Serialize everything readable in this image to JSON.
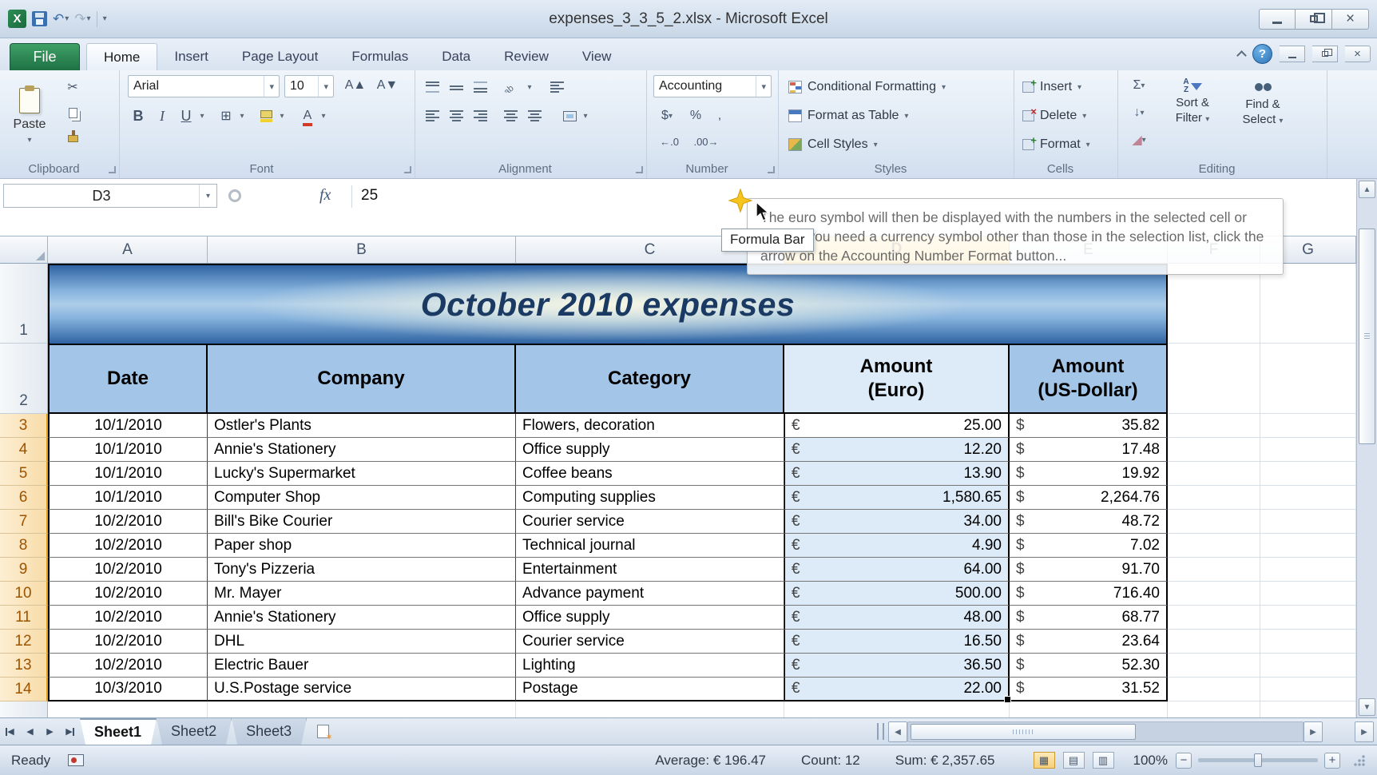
{
  "window": {
    "title": "expenses_3_3_5_2.xlsx  -  Microsoft Excel"
  },
  "tabs": {
    "file": "File",
    "items": [
      "Home",
      "Insert",
      "Page Layout",
      "Formulas",
      "Data",
      "Review",
      "View"
    ]
  },
  "ribbon": {
    "paste_label": "Paste",
    "font_name": "Arial",
    "font_size": "10",
    "number_format": "Accounting",
    "conditional_formatting": "Conditional Formatting",
    "format_as_table": "Format as Table",
    "cell_styles": "Cell Styles",
    "insert_label": "Insert",
    "delete_label": "Delete",
    "format_label": "Format",
    "sort_line1": "Sort &",
    "sort_line2": "Filter",
    "find_line1": "Find &",
    "find_line2": "Select",
    "groups": {
      "clipboard": "Clipboard",
      "font": "Font",
      "alignment": "Alignment",
      "number": "Number",
      "styles": "Styles",
      "cells": "Cells",
      "editing": "Editing"
    },
    "tooltip": "The euro symbol will then be displayed with the numbers in the selected cell or cells. If you need a currency symbol other than those in the selection list, click the arrow on the Accounting Number Format button..."
  },
  "formula_bar": {
    "name_box": "D3",
    "fx": "fx",
    "value": "25",
    "tooltip": "Formula Bar"
  },
  "sheet": {
    "columns": [
      "A",
      "B",
      "C",
      "D",
      "E",
      "F",
      "G"
    ],
    "selected_column": "D",
    "row1_num": "1",
    "row2_num": "2",
    "title": "October 2010 expenses",
    "headers": {
      "date": "Date",
      "company": "Company",
      "category": "Category",
      "eur1": "Amount",
      "eur2": "(Euro)",
      "usd1": "Amount",
      "usd2": "(US-Dollar)"
    },
    "currency": {
      "eur": "€",
      "usd": "$"
    },
    "rows": [
      {
        "n": 3,
        "date": "10/1/2010",
        "company": "Ostler's Plants",
        "category": "Flowers, decoration",
        "eur": "25.00",
        "usd": "35.82"
      },
      {
        "n": 4,
        "date": "10/1/2010",
        "company": "Annie's Stationery",
        "category": "Office supply",
        "eur": "12.20",
        "usd": "17.48"
      },
      {
        "n": 5,
        "date": "10/1/2010",
        "company": "Lucky's Supermarket",
        "category": "Coffee beans",
        "eur": "13.90",
        "usd": "19.92"
      },
      {
        "n": 6,
        "date": "10/1/2010",
        "company": "Computer Shop",
        "category": "Computing supplies",
        "eur": "1,580.65",
        "usd": "2,264.76"
      },
      {
        "n": 7,
        "date": "10/2/2010",
        "company": "Bill's Bike Courier",
        "category": "Courier service",
        "eur": "34.00",
        "usd": "48.72"
      },
      {
        "n": 8,
        "date": "10/2/2010",
        "company": "Paper shop",
        "category": "Technical journal",
        "eur": "4.90",
        "usd": "7.02"
      },
      {
        "n": 9,
        "date": "10/2/2010",
        "company": "Tony's Pizzeria",
        "category": "Entertainment",
        "eur": "64.00",
        "usd": "91.70"
      },
      {
        "n": 10,
        "date": "10/2/2010",
        "company": "Mr. Mayer",
        "category": "Advance payment",
        "eur": "500.00",
        "usd": "716.40"
      },
      {
        "n": 11,
        "date": "10/2/2010",
        "company": "Annie's Stationery",
        "category": "Office supply",
        "eur": "48.00",
        "usd": "68.77"
      },
      {
        "n": 12,
        "date": "10/2/2010",
        "company": "DHL",
        "category": "Courier service",
        "eur": "16.50",
        "usd": "23.64"
      },
      {
        "n": 13,
        "date": "10/2/2010",
        "company": "Electric Bauer",
        "category": "Lighting",
        "eur": "36.50",
        "usd": "52.30"
      },
      {
        "n": 14,
        "date": "10/3/2010",
        "company": "U.S.Postage service",
        "category": "Postage",
        "eur": "22.00",
        "usd": "31.52"
      }
    ]
  },
  "sheet_tabs": {
    "items": [
      "Sheet1",
      "Sheet2",
      "Sheet3"
    ]
  },
  "status": {
    "ready": "Ready",
    "average": "Average:  € 196.47",
    "count": "Count: 12",
    "sum": "Sum:  € 2,357.65",
    "zoom": "100%"
  },
  "icons": {
    "dropdown": "▾",
    "undo": "↶",
    "redo": "↷",
    "cut": "✂",
    "sigma": "Σ",
    "bold": "B",
    "italic": "I",
    "underline": "U",
    "borders": "⊞",
    "grow_font": "A▲",
    "shrink_font": "A▼",
    "dollar": "$",
    "percent": "%",
    "comma": ",",
    "increase_decimal": "←.0",
    "decrease_decimal": ".00→",
    "fill_down": "↓",
    "clear": "◢",
    "help": "?",
    "scroll_up": "▲",
    "scroll_down": "▼",
    "scroll_left": "◀",
    "scroll_right": "▶",
    "view_normal": "▦",
    "view_layout": "▤",
    "view_break": "▥"
  },
  "colors": {
    "header_fill": "#A3C6E8",
    "selection_fill": "#DCEBF7",
    "selected_col_header": "#F6BF3E",
    "title_text": "#1B3A63",
    "file_tab_green": "#1E7145"
  }
}
